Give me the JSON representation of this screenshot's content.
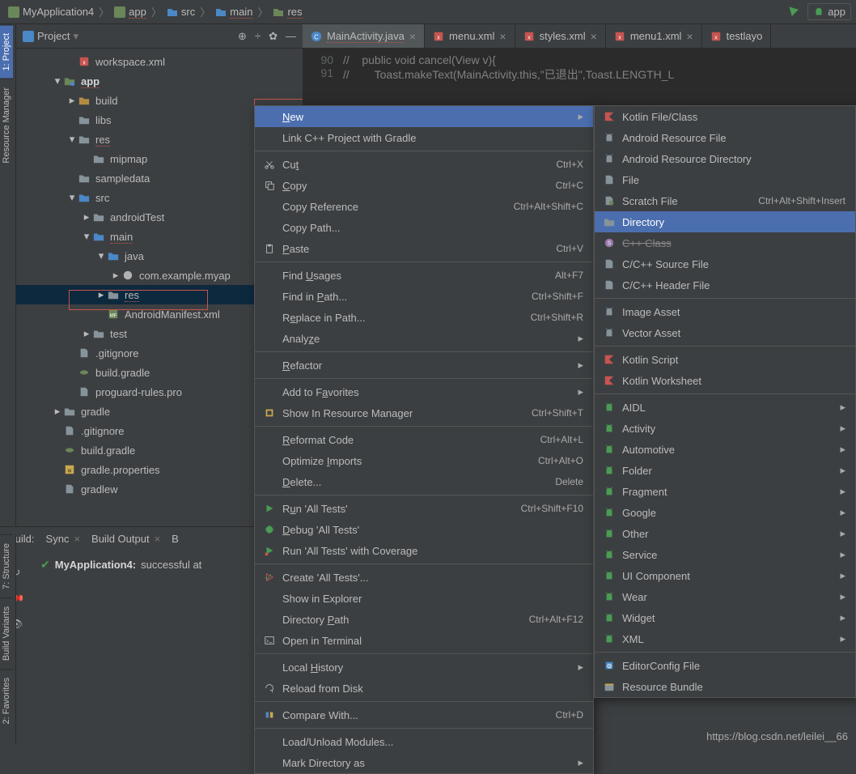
{
  "breadcrumb": [
    "MyApplication4",
    "app",
    "src",
    "main",
    "res"
  ],
  "breadcrumb_right": "app",
  "sidebar_tabs": [
    "1: Project",
    "Resource Manager"
  ],
  "project_panel": {
    "title": "Project"
  },
  "tree": [
    {
      "depth": 3,
      "arrow": "none",
      "icon": "xml",
      "label": "workspace.xml"
    },
    {
      "depth": 2,
      "arrow": "down",
      "icon": "module",
      "label": "app",
      "bold": true,
      "underline": true
    },
    {
      "depth": 3,
      "arrow": "right",
      "icon": "folder-y",
      "label": "build"
    },
    {
      "depth": 3,
      "arrow": "none",
      "icon": "folder-g",
      "label": "libs"
    },
    {
      "depth": 3,
      "arrow": "down",
      "icon": "folder-g",
      "label": "res",
      "underline": true
    },
    {
      "depth": 4,
      "arrow": "none",
      "icon": "folder-g",
      "label": "mipmap"
    },
    {
      "depth": 3,
      "arrow": "none",
      "icon": "folder-g",
      "label": "sampledata"
    },
    {
      "depth": 3,
      "arrow": "down",
      "icon": "folder-b",
      "label": "src"
    },
    {
      "depth": 4,
      "arrow": "right",
      "icon": "folder-g",
      "label": "androidTest"
    },
    {
      "depth": 4,
      "arrow": "down",
      "icon": "folder-b",
      "label": "main",
      "underline": true
    },
    {
      "depth": 5,
      "arrow": "down",
      "icon": "folder-b",
      "label": "java"
    },
    {
      "depth": 6,
      "arrow": "right",
      "icon": "pkg",
      "label": "com.example.myap"
    },
    {
      "depth": 5,
      "arrow": "right",
      "icon": "folder-g",
      "label": "res",
      "selected": true,
      "underline": true
    },
    {
      "depth": 5,
      "arrow": "none",
      "icon": "mf",
      "label": "AndroidManifest.xml"
    },
    {
      "depth": 4,
      "arrow": "right",
      "icon": "folder-g",
      "label": "test"
    },
    {
      "depth": 3,
      "arrow": "none",
      "icon": "file",
      "label": ".gitignore"
    },
    {
      "depth": 3,
      "arrow": "none",
      "icon": "gradle",
      "label": "build.gradle"
    },
    {
      "depth": 3,
      "arrow": "none",
      "icon": "file",
      "label": "proguard-rules.pro"
    },
    {
      "depth": 2,
      "arrow": "right",
      "icon": "folder-g",
      "label": "gradle"
    },
    {
      "depth": 2,
      "arrow": "none",
      "icon": "file",
      "label": ".gitignore"
    },
    {
      "depth": 2,
      "arrow": "none",
      "icon": "gradle",
      "label": "build.gradle"
    },
    {
      "depth": 2,
      "arrow": "none",
      "icon": "props",
      "label": "gradle.properties"
    },
    {
      "depth": 2,
      "arrow": "none",
      "icon": "file",
      "label": "gradlew"
    }
  ],
  "editor_tabs": [
    {
      "label": "MainActivity.java",
      "icon": "class",
      "active": true,
      "underline": true
    },
    {
      "label": "menu.xml",
      "icon": "xml"
    },
    {
      "label": "styles.xml",
      "icon": "xml"
    },
    {
      "label": "menu1.xml",
      "icon": "xml"
    },
    {
      "label": "testlayo",
      "icon": "xml",
      "noclose": true
    }
  ],
  "code_lines": [
    {
      "num": "90",
      "text": "//    public void cancel(View v){"
    },
    {
      "num": "91",
      "text": "//        Toast.makeText(MainActivity.this,\"已退出\",Toast.LENGTH_L"
    }
  ],
  "context_menu": [
    {
      "type": "item",
      "label": "New",
      "highlight": true,
      "sub": true,
      "u": 0
    },
    {
      "type": "item",
      "label": "Link C++ Project with Gradle"
    },
    {
      "type": "sep"
    },
    {
      "type": "item",
      "icon": "cut",
      "label": "Cut",
      "shortcut": "Ctrl+X",
      "u": 2
    },
    {
      "type": "item",
      "icon": "copy",
      "label": "Copy",
      "shortcut": "Ctrl+C",
      "u": 0
    },
    {
      "type": "item",
      "label": "Copy Reference",
      "shortcut": "Ctrl+Alt+Shift+C"
    },
    {
      "type": "item",
      "label": "Copy Path..."
    },
    {
      "type": "item",
      "icon": "paste",
      "label": "Paste",
      "shortcut": "Ctrl+V",
      "u": 0
    },
    {
      "type": "sep"
    },
    {
      "type": "item",
      "label": "Find Usages",
      "shortcut": "Alt+F7",
      "u": 5
    },
    {
      "type": "item",
      "label": "Find in Path...",
      "shortcut": "Ctrl+Shift+F",
      "u": 8
    },
    {
      "type": "item",
      "label": "Replace in Path...",
      "shortcut": "Ctrl+Shift+R",
      "u": 1
    },
    {
      "type": "item",
      "label": "Analyze",
      "sub": true,
      "u": 5
    },
    {
      "type": "sep"
    },
    {
      "type": "item",
      "label": "Refactor",
      "sub": true,
      "u": 0
    },
    {
      "type": "sep"
    },
    {
      "type": "item",
      "label": "Add to Favorites",
      "sub": true,
      "u": 8
    },
    {
      "type": "item",
      "icon": "res",
      "label": "Show In Resource Manager",
      "shortcut": "Ctrl+Shift+T"
    },
    {
      "type": "sep"
    },
    {
      "type": "item",
      "label": "Reformat Code",
      "shortcut": "Ctrl+Alt+L",
      "u": 0
    },
    {
      "type": "item",
      "label": "Optimize Imports",
      "shortcut": "Ctrl+Alt+O",
      "u": 9
    },
    {
      "type": "item",
      "label": "Delete...",
      "shortcut": "Delete",
      "u": 0
    },
    {
      "type": "sep"
    },
    {
      "type": "item",
      "icon": "run",
      "label": "Run 'All Tests'",
      "shortcut": "Ctrl+Shift+F10",
      "u": 1
    },
    {
      "type": "item",
      "icon": "debug",
      "label": "Debug 'All Tests'",
      "u": 0
    },
    {
      "type": "item",
      "icon": "cov",
      "label": "Run 'All Tests' with Coverage"
    },
    {
      "type": "sep"
    },
    {
      "type": "item",
      "icon": "create",
      "label": "Create 'All Tests'..."
    },
    {
      "type": "item",
      "label": "Show in Explorer"
    },
    {
      "type": "item",
      "label": "Directory Path",
      "shortcut": "Ctrl+Alt+F12",
      "u": 10
    },
    {
      "type": "item",
      "icon": "term",
      "label": "Open in Terminal"
    },
    {
      "type": "sep"
    },
    {
      "type": "item",
      "label": "Local History",
      "sub": true,
      "u": 6
    },
    {
      "type": "item",
      "icon": "reload",
      "label": "Reload from Disk"
    },
    {
      "type": "sep"
    },
    {
      "type": "item",
      "icon": "compare",
      "label": "Compare With...",
      "shortcut": "Ctrl+D"
    },
    {
      "type": "sep"
    },
    {
      "type": "item",
      "label": "Load/Unload Modules..."
    },
    {
      "type": "item",
      "label": "Mark Directory as",
      "sub": true
    }
  ],
  "submenu": [
    {
      "type": "item",
      "icon": "kotlin",
      "label": "Kotlin File/Class"
    },
    {
      "type": "item",
      "icon": "android",
      "label": "Android Resource File"
    },
    {
      "type": "item",
      "icon": "android",
      "label": "Android Resource Directory"
    },
    {
      "type": "item",
      "icon": "file",
      "label": "File"
    },
    {
      "type": "item",
      "icon": "scratch",
      "label": "Scratch File",
      "shortcut": "Ctrl+Alt+Shift+Insert"
    },
    {
      "type": "item",
      "icon": "folder",
      "label": "Directory",
      "highlight": true
    },
    {
      "type": "item",
      "icon": "cpp",
      "label": "C++ Class",
      "strike": true
    },
    {
      "type": "item",
      "icon": "file",
      "label": "C/C++ Source File"
    },
    {
      "type": "item",
      "icon": "file",
      "label": "C/C++ Header File"
    },
    {
      "type": "sep"
    },
    {
      "type": "item",
      "icon": "android",
      "label": "Image Asset"
    },
    {
      "type": "item",
      "icon": "android",
      "label": "Vector Asset"
    },
    {
      "type": "sep"
    },
    {
      "type": "item",
      "icon": "kotlin",
      "label": "Kotlin Script"
    },
    {
      "type": "item",
      "icon": "kotlin",
      "label": "Kotlin Worksheet"
    },
    {
      "type": "sep"
    },
    {
      "type": "item",
      "icon": "android-g",
      "label": "AIDL",
      "sub": true
    },
    {
      "type": "item",
      "icon": "android-g",
      "label": "Activity",
      "sub": true
    },
    {
      "type": "item",
      "icon": "android-g",
      "label": "Automotive",
      "sub": true
    },
    {
      "type": "item",
      "icon": "android-g",
      "label": "Folder",
      "sub": true
    },
    {
      "type": "item",
      "icon": "android-g",
      "label": "Fragment",
      "sub": true
    },
    {
      "type": "item",
      "icon": "android-g",
      "label": "Google",
      "sub": true
    },
    {
      "type": "item",
      "icon": "android-g",
      "label": "Other",
      "sub": true
    },
    {
      "type": "item",
      "icon": "android-g",
      "label": "Service",
      "sub": true
    },
    {
      "type": "item",
      "icon": "android-g",
      "label": "UI Component",
      "sub": true
    },
    {
      "type": "item",
      "icon": "android-g",
      "label": "Wear",
      "sub": true
    },
    {
      "type": "item",
      "icon": "android-g",
      "label": "Widget",
      "sub": true
    },
    {
      "type": "item",
      "icon": "android-g",
      "label": "XML",
      "sub": true
    },
    {
      "type": "sep"
    },
    {
      "type": "item",
      "icon": "edit",
      "label": "EditorConfig File"
    },
    {
      "type": "item",
      "icon": "bundle",
      "label": "Resource Bundle"
    }
  ],
  "build": {
    "title": "Build:",
    "tabs": [
      "Sync",
      "Build Output",
      "B"
    ],
    "success_project": "MyApplication4:",
    "success_msg": "successful at"
  },
  "watermark": "https://blog.csdn.net/leilei__66"
}
